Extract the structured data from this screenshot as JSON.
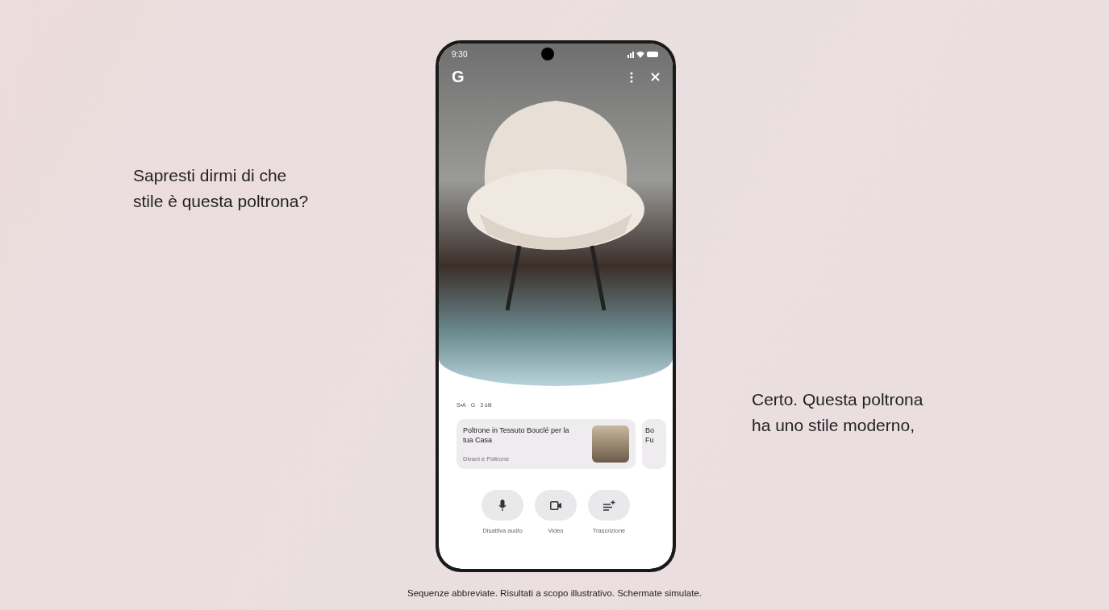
{
  "question": "Sapresti dirmi di che stile è questa poltrona?",
  "answer": "Certo. Questa poltrona ha uno stile moderno,",
  "phone": {
    "status_bar": {
      "time": "9:30"
    },
    "top_bar": {
      "logo": "G"
    },
    "sources": {
      "labels": [
        "S•A",
        "G"
      ],
      "count": "3 siti"
    },
    "cards": [
      {
        "title": "Poltrone in Tessuto Bouclé per la tua Casa",
        "source": "Divani e Poltrone"
      },
      {
        "title": "Bo Fu"
      }
    ],
    "controls": [
      {
        "label": "Disattiva audio",
        "kind": "mic"
      },
      {
        "label": "Video",
        "kind": "video"
      },
      {
        "label": "Trascrizione",
        "kind": "transcript"
      }
    ]
  },
  "disclaimer": "Sequenze abbreviate. Risultati a scopo illustrativo. Schermate simulate."
}
